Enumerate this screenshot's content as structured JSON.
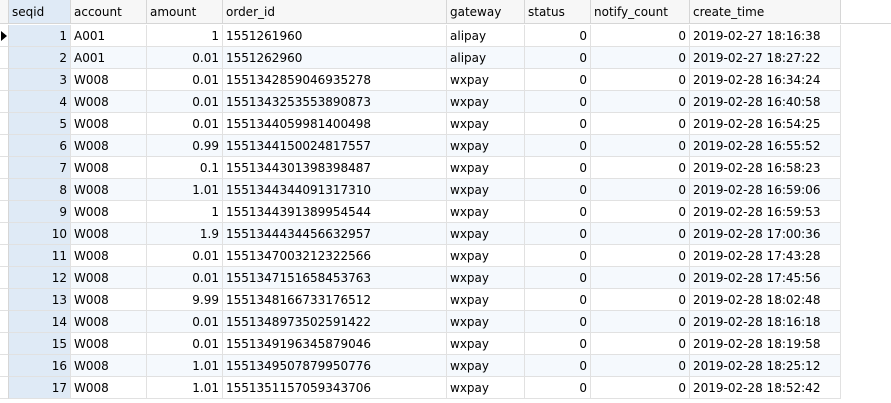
{
  "table": {
    "columns": [
      {
        "key": "seqid",
        "label": "seqid"
      },
      {
        "key": "account",
        "label": "account"
      },
      {
        "key": "amount",
        "label": "amount"
      },
      {
        "key": "order_id",
        "label": "order_id"
      },
      {
        "key": "gateway",
        "label": "gateway"
      },
      {
        "key": "status",
        "label": "status"
      },
      {
        "key": "notify_count",
        "label": "notify_count"
      },
      {
        "key": "create_time",
        "label": "create_time"
      }
    ],
    "current_row_marker": "current-row-arrow-icon",
    "rows": [
      {
        "seqid": "1",
        "account": "A001",
        "amount": "1",
        "order_id": "1551261960",
        "gateway": "alipay",
        "status": "0",
        "notify_count": "0",
        "create_time": "2019-02-27 18:16:38"
      },
      {
        "seqid": "2",
        "account": "A001",
        "amount": "0.01",
        "order_id": "1551262960",
        "gateway": "alipay",
        "status": "0",
        "notify_count": "0",
        "create_time": "2019-02-27 18:27:22"
      },
      {
        "seqid": "3",
        "account": "W008",
        "amount": "0.01",
        "order_id": "1551342859046935278",
        "gateway": "wxpay",
        "status": "0",
        "notify_count": "0",
        "create_time": "2019-02-28 16:34:24"
      },
      {
        "seqid": "4",
        "account": "W008",
        "amount": "0.01",
        "order_id": "1551343253553890873",
        "gateway": "wxpay",
        "status": "0",
        "notify_count": "0",
        "create_time": "2019-02-28 16:40:58"
      },
      {
        "seqid": "5",
        "account": "W008",
        "amount": "0.01",
        "order_id": "1551344059981400498",
        "gateway": "wxpay",
        "status": "0",
        "notify_count": "0",
        "create_time": "2019-02-28 16:54:25"
      },
      {
        "seqid": "6",
        "account": "W008",
        "amount": "0.99",
        "order_id": "1551344150024817557",
        "gateway": "wxpay",
        "status": "0",
        "notify_count": "0",
        "create_time": "2019-02-28 16:55:52"
      },
      {
        "seqid": "7",
        "account": "W008",
        "amount": "0.1",
        "order_id": "1551344301398398487",
        "gateway": "wxpay",
        "status": "0",
        "notify_count": "0",
        "create_time": "2019-02-28 16:58:23"
      },
      {
        "seqid": "8",
        "account": "W008",
        "amount": "1.01",
        "order_id": "1551344344091317310",
        "gateway": "wxpay",
        "status": "0",
        "notify_count": "0",
        "create_time": "2019-02-28 16:59:06"
      },
      {
        "seqid": "9",
        "account": "W008",
        "amount": "1",
        "order_id": "1551344391389954544",
        "gateway": "wxpay",
        "status": "0",
        "notify_count": "0",
        "create_time": "2019-02-28 16:59:53"
      },
      {
        "seqid": "10",
        "account": "W008",
        "amount": "1.9",
        "order_id": "1551344434456632957",
        "gateway": "wxpay",
        "status": "0",
        "notify_count": "0",
        "create_time": "2019-02-28 17:00:36"
      },
      {
        "seqid": "11",
        "account": "W008",
        "amount": "0.01",
        "order_id": "1551347003212322566",
        "gateway": "wxpay",
        "status": "0",
        "notify_count": "0",
        "create_time": "2019-02-28 17:43:28"
      },
      {
        "seqid": "12",
        "account": "W008",
        "amount": "0.01",
        "order_id": "1551347151658453763",
        "gateway": "wxpay",
        "status": "0",
        "notify_count": "0",
        "create_time": "2019-02-28 17:45:56"
      },
      {
        "seqid": "13",
        "account": "W008",
        "amount": "9.99",
        "order_id": "1551348166733176512",
        "gateway": "wxpay",
        "status": "0",
        "notify_count": "0",
        "create_time": "2019-02-28 18:02:48"
      },
      {
        "seqid": "14",
        "account": "W008",
        "amount": "0.01",
        "order_id": "1551348973502591422",
        "gateway": "wxpay",
        "status": "0",
        "notify_count": "0",
        "create_time": "2019-02-28 18:16:18"
      },
      {
        "seqid": "15",
        "account": "W008",
        "amount": "0.01",
        "order_id": "1551349196345879046",
        "gateway": "wxpay",
        "status": "0",
        "notify_count": "0",
        "create_time": "2019-02-28 18:19:58"
      },
      {
        "seqid": "16",
        "account": "W008",
        "amount": "1.01",
        "order_id": "1551349507879950776",
        "gateway": "wxpay",
        "status": "0",
        "notify_count": "0",
        "create_time": "2019-02-28 18:25:12"
      },
      {
        "seqid": "17",
        "account": "W008",
        "amount": "1.01",
        "order_id": "1551351157059343706",
        "gateway": "wxpay",
        "status": "0",
        "notify_count": "0",
        "create_time": "2019-02-28 18:52:42"
      }
    ]
  },
  "colors": {
    "header_bg": "#f7f7f7",
    "selected_bg": "#dfeaf6",
    "alt_row_bg": "#f5f9fd",
    "grid_line": "#e1e1e1"
  }
}
